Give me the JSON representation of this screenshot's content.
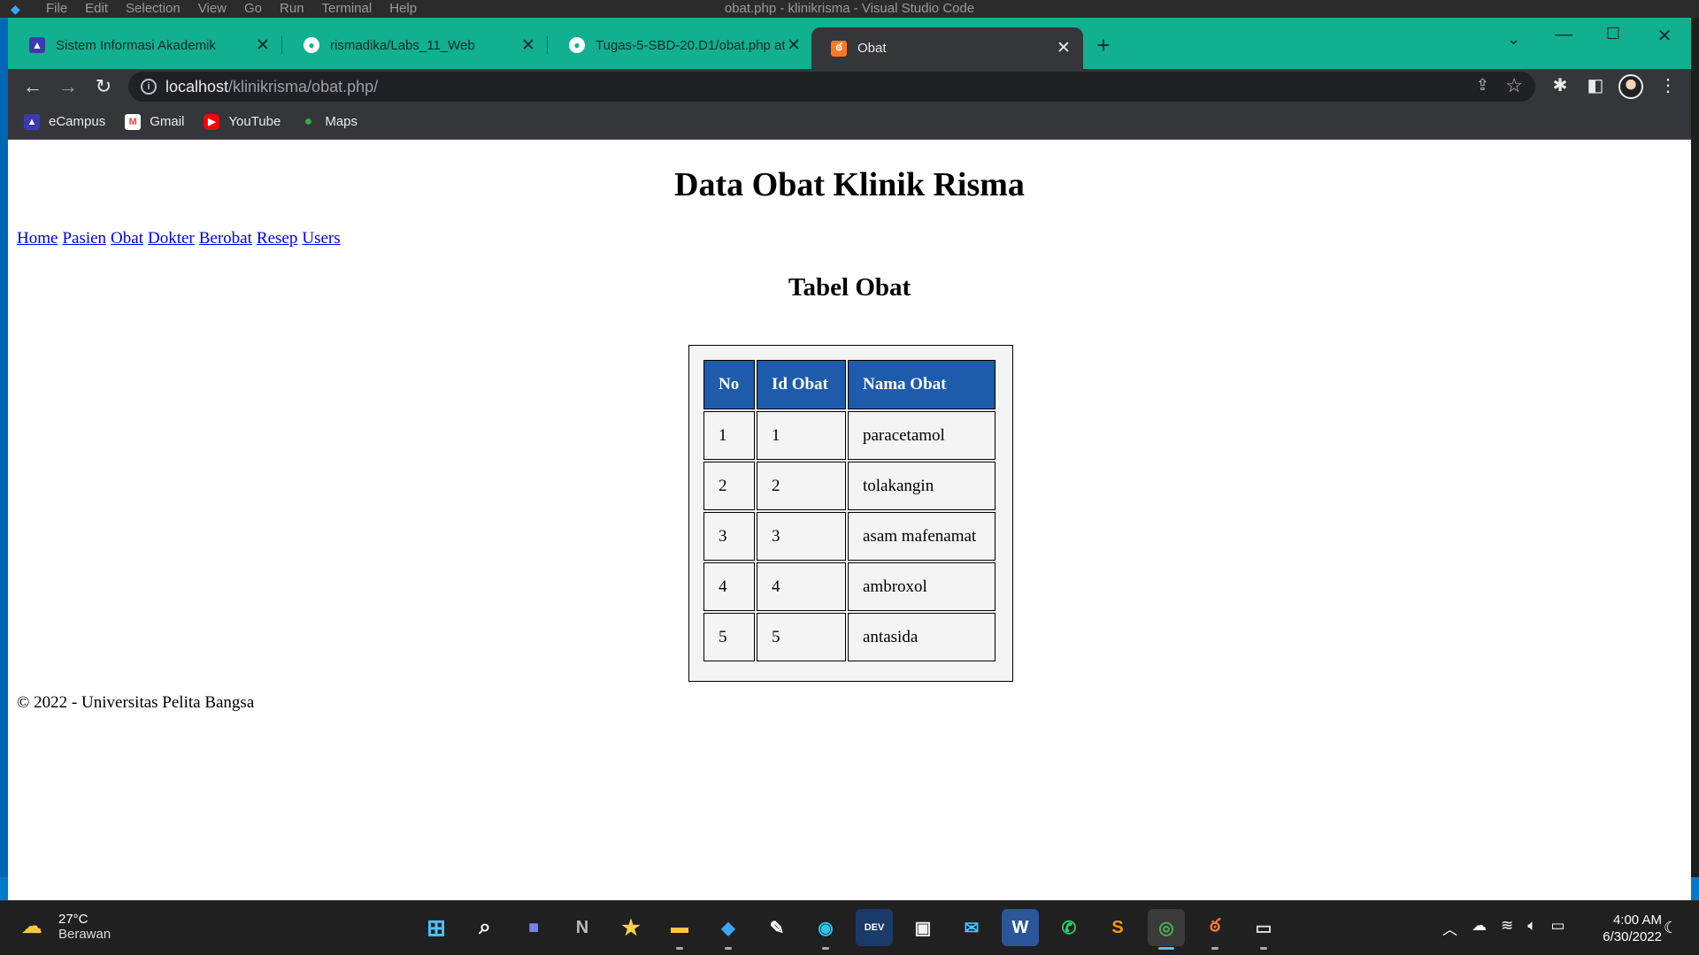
{
  "vscode": {
    "menu": [
      "File",
      "Edit",
      "Selection",
      "View",
      "Go",
      "Run",
      "Terminal",
      "Help"
    ],
    "title": "obat.php - klinikrisma - Visual Studio Code"
  },
  "browser": {
    "tabs": [
      {
        "label": "Sistem Informasi Akademik",
        "icon": "campus-icon"
      },
      {
        "label": "rismadika/Labs_11_Web",
        "icon": "github-icon"
      },
      {
        "label": "Tugas-5-SBD-20.D1/obat.php at",
        "icon": "github-icon"
      },
      {
        "label": "Obat",
        "icon": "xampp-icon"
      }
    ],
    "url_host": "localhost",
    "url_path": "/klinikrisma/obat.php/",
    "bookmarks": [
      {
        "label": "eCampus",
        "icon": "campus-icon",
        "color": "#3b3bb0"
      },
      {
        "label": "Gmail",
        "icon": "gmail-icon",
        "color": "#ea4335"
      },
      {
        "label": "YouTube",
        "icon": "youtube-icon",
        "color": "#ff0000"
      },
      {
        "label": "Maps",
        "icon": "maps-icon",
        "color": "#34a853"
      }
    ],
    "accent_color": "#10b090"
  },
  "page": {
    "title": "Data Obat Klinik Risma",
    "nav": [
      "Home",
      "Pasien",
      "Obat",
      "Dokter",
      "Berobat",
      "Resep",
      "Users"
    ],
    "subtitle": "Tabel Obat",
    "table": {
      "headers": [
        "No",
        "Id Obat",
        "Nama Obat"
      ],
      "rows": [
        [
          "1",
          "1",
          "paracetamol"
        ],
        [
          "2",
          "2",
          "tolakangin"
        ],
        [
          "3",
          "3",
          "asam mafenamat"
        ],
        [
          "4",
          "4",
          "ambroxol"
        ],
        [
          "5",
          "5",
          "antasida"
        ]
      ],
      "header_color": "#1e5bab"
    },
    "footer": "© 2022 - Universitas Pelita Bangsa"
  },
  "taskbar": {
    "weather_temp": "27°C",
    "weather_desc": "Berawan",
    "time": "4:00 AM",
    "date": "6/30/2022"
  }
}
